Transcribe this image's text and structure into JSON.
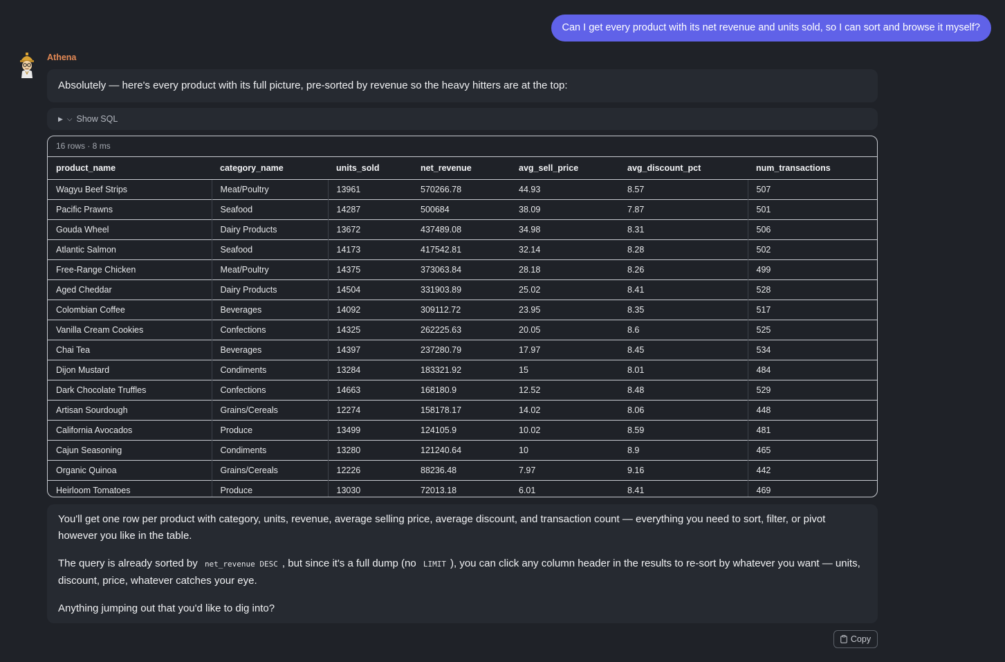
{
  "user_message": "Can I get every product with its net revenue and units sold, so I can sort and browse it myself?",
  "assistant": {
    "name": "Athena",
    "intro": "Absolutely — here's every product with its full picture, pre-sorted by revenue so the heavy hitters are at the top:",
    "sql_toggle": "Show SQL"
  },
  "results": {
    "meta": "16 rows · 8 ms",
    "columns": [
      "product_name",
      "category_name",
      "units_sold",
      "net_revenue",
      "avg_sell_price",
      "avg_discount_pct",
      "num_transactions"
    ],
    "rows": [
      [
        "Wagyu Beef Strips",
        "Meat/Poultry",
        "13961",
        "570266.78",
        "44.93",
        "8.57",
        "507"
      ],
      [
        "Pacific Prawns",
        "Seafood",
        "14287",
        "500684",
        "38.09",
        "7.87",
        "501"
      ],
      [
        "Gouda Wheel",
        "Dairy Products",
        "13672",
        "437489.08",
        "34.98",
        "8.31",
        "506"
      ],
      [
        "Atlantic Salmon",
        "Seafood",
        "14173",
        "417542.81",
        "32.14",
        "8.28",
        "502"
      ],
      [
        "Free-Range Chicken",
        "Meat/Poultry",
        "14375",
        "373063.84",
        "28.18",
        "8.26",
        "499"
      ],
      [
        "Aged Cheddar",
        "Dairy Products",
        "14504",
        "331903.89",
        "25.02",
        "8.41",
        "528"
      ],
      [
        "Colombian Coffee",
        "Beverages",
        "14092",
        "309112.72",
        "23.95",
        "8.35",
        "517"
      ],
      [
        "Vanilla Cream Cookies",
        "Confections",
        "14325",
        "262225.63",
        "20.05",
        "8.6",
        "525"
      ],
      [
        "Chai Tea",
        "Beverages",
        "14397",
        "237280.79",
        "17.97",
        "8.45",
        "534"
      ],
      [
        "Dijon Mustard",
        "Condiments",
        "13284",
        "183321.92",
        "15",
        "8.01",
        "484"
      ],
      [
        "Dark Chocolate Truffles",
        "Confections",
        "14663",
        "168180.9",
        "12.52",
        "8.48",
        "529"
      ],
      [
        "Artisan Sourdough",
        "Grains/Cereals",
        "12274",
        "158178.17",
        "14.02",
        "8.06",
        "448"
      ],
      [
        "California Avocados",
        "Produce",
        "13499",
        "124105.9",
        "10.02",
        "8.59",
        "481"
      ],
      [
        "Cajun Seasoning",
        "Condiments",
        "13280",
        "121240.64",
        "10",
        "8.9",
        "465"
      ],
      [
        "Organic Quinoa",
        "Grains/Cereals",
        "12226",
        "88236.48",
        "7.97",
        "9.16",
        "442"
      ],
      [
        "Heirloom Tomatoes",
        "Produce",
        "13030",
        "72013.18",
        "6.01",
        "8.41",
        "469"
      ]
    ]
  },
  "outro": {
    "p1": "You'll get one row per product with category, units, revenue, average selling price, average discount, and transaction count — everything you need to sort, filter, or pivot however you like in the table.",
    "p2_before": "The query is already sorted by ",
    "p2_code1": "net_revenue DESC",
    "p2_middle": ", but since it's a full dump (no ",
    "p2_code2": "LIMIT",
    "p2_after": "), you can click any column header in the results to re-sort by whatever you want — units, discount, price, whatever catches your eye.",
    "p3": "Anything jumping out that you'd like to dig into?"
  },
  "copy_label": "Copy",
  "colors": {
    "user_bubble": "#6062e8",
    "assistant_name": "#e58a55",
    "background": "#1f2228",
    "panel": "#262a31"
  }
}
